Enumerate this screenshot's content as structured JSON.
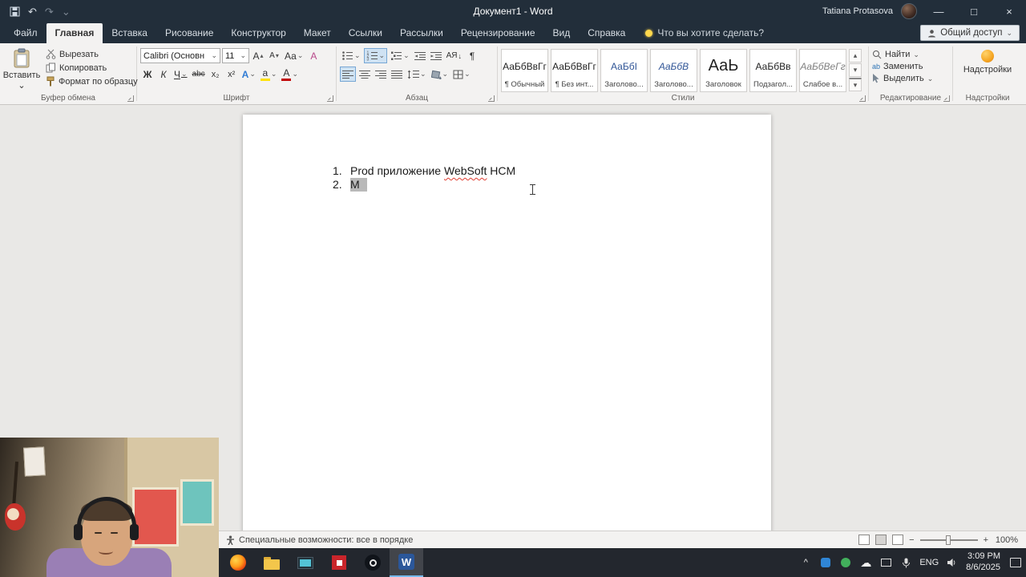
{
  "titlebar": {
    "title": "Документ1  -  Word",
    "user_name": "Tatiana Protasova"
  },
  "tabs": {
    "items": [
      {
        "label": "Файл"
      },
      {
        "label": "Главная"
      },
      {
        "label": "Вставка"
      },
      {
        "label": "Рисование"
      },
      {
        "label": "Конструктор"
      },
      {
        "label": "Макет"
      },
      {
        "label": "Ссылки"
      },
      {
        "label": "Рассылки"
      },
      {
        "label": "Рецензирование"
      },
      {
        "label": "Вид"
      },
      {
        "label": "Справка"
      }
    ],
    "tell_me": "Что вы хотите сделать?",
    "share_label": "Общий доступ"
  },
  "ribbon": {
    "clipboard": {
      "group_label": "Буфер обмена",
      "paste_label": "Вставить",
      "cut_label": "Вырезать",
      "copy_label": "Копировать",
      "format_painter_label": "Формат по образцу"
    },
    "font": {
      "group_label": "Шрифт",
      "font_name": "Calibri (Основн",
      "font_size": "11",
      "grow_font_label": "А",
      "shrink_font_label": "А",
      "change_case_label": "Аа",
      "clear_format_label": "А",
      "bold_label": "Ж",
      "italic_label": "К",
      "underline_label": "Ч",
      "strikethrough_label": "abc",
      "subscript_label": "х₂",
      "superscript_label": "х²",
      "text_effects_label": "А",
      "highlight_label": "а",
      "font_color_label": "А"
    },
    "paragraph": {
      "group_label": "Абзац",
      "sort_label": "АЯ"
    },
    "styles": {
      "group_label": "Стили",
      "items": [
        {
          "sample": "АаБбВвГг",
          "name": "¶ Обычный"
        },
        {
          "sample": "АаБбВвГг",
          "name": "¶ Без инт..."
        },
        {
          "sample": "АаБбІ",
          "name": "Заголово..."
        },
        {
          "sample": "АаБбВ",
          "name": "Заголово..."
        },
        {
          "sample": "АаЬ",
          "name": "Заголовок"
        },
        {
          "sample": "АаБбВв",
          "name": "Подзагол..."
        },
        {
          "sample": "АаБбВеГг",
          "name": "Слабое в..."
        }
      ]
    },
    "editing": {
      "group_label": "Редактирование",
      "find_label": "Найти",
      "replace_label": "Заменить",
      "select_label": "Выделить",
      "replace_icon_text": "ab"
    },
    "addins": {
      "group_label": "Надстройки",
      "button_label": "Надстройки"
    }
  },
  "document": {
    "line1": {
      "number": "1.",
      "before": "Prod приложение ",
      "misspelled": "WebSoft",
      "after": " HCM"
    },
    "line2": {
      "number": "2.",
      "text": "М"
    }
  },
  "statusbar": {
    "accessibility_text": "Специальные возможности: все в порядке",
    "zoom_level": "100%"
  },
  "taskbar": {
    "lang": "ENG",
    "time": "3:09 PM",
    "date": "8/6/2025",
    "word_letter": "W"
  },
  "icons": {
    "chevron_down": "⌄",
    "chevron_up": "^",
    "undo": "↶",
    "redo": "↷",
    "minimize": "—",
    "maximize": "□",
    "close": "×",
    "pilcrow": "¶",
    "down_arrow": "↓",
    "gallery_up": "▴",
    "gallery_down": "▾",
    "gallery_more": "▾",
    "zoom_out": "−",
    "zoom_in": "+",
    "cloud": "☁"
  }
}
